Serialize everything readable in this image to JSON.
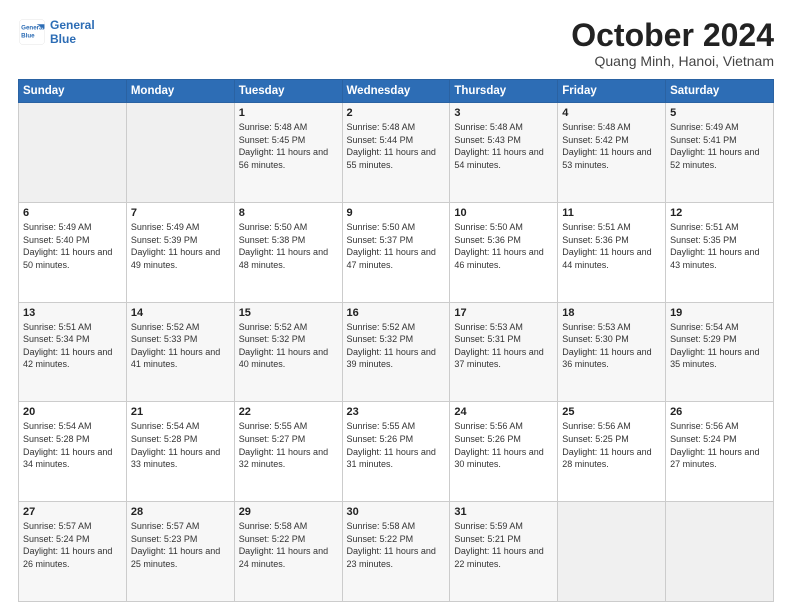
{
  "header": {
    "logo_line1": "General",
    "logo_line2": "Blue",
    "month": "October 2024",
    "location": "Quang Minh, Hanoi, Vietnam"
  },
  "weekdays": [
    "Sunday",
    "Monday",
    "Tuesday",
    "Wednesday",
    "Thursday",
    "Friday",
    "Saturday"
  ],
  "weeks": [
    [
      {
        "day": "",
        "info": ""
      },
      {
        "day": "",
        "info": ""
      },
      {
        "day": "1",
        "info": "Sunrise: 5:48 AM\nSunset: 5:45 PM\nDaylight: 11 hours and 56 minutes."
      },
      {
        "day": "2",
        "info": "Sunrise: 5:48 AM\nSunset: 5:44 PM\nDaylight: 11 hours and 55 minutes."
      },
      {
        "day": "3",
        "info": "Sunrise: 5:48 AM\nSunset: 5:43 PM\nDaylight: 11 hours and 54 minutes."
      },
      {
        "day": "4",
        "info": "Sunrise: 5:48 AM\nSunset: 5:42 PM\nDaylight: 11 hours and 53 minutes."
      },
      {
        "day": "5",
        "info": "Sunrise: 5:49 AM\nSunset: 5:41 PM\nDaylight: 11 hours and 52 minutes."
      }
    ],
    [
      {
        "day": "6",
        "info": "Sunrise: 5:49 AM\nSunset: 5:40 PM\nDaylight: 11 hours and 50 minutes."
      },
      {
        "day": "7",
        "info": "Sunrise: 5:49 AM\nSunset: 5:39 PM\nDaylight: 11 hours and 49 minutes."
      },
      {
        "day": "8",
        "info": "Sunrise: 5:50 AM\nSunset: 5:38 PM\nDaylight: 11 hours and 48 minutes."
      },
      {
        "day": "9",
        "info": "Sunrise: 5:50 AM\nSunset: 5:37 PM\nDaylight: 11 hours and 47 minutes."
      },
      {
        "day": "10",
        "info": "Sunrise: 5:50 AM\nSunset: 5:36 PM\nDaylight: 11 hours and 46 minutes."
      },
      {
        "day": "11",
        "info": "Sunrise: 5:51 AM\nSunset: 5:36 PM\nDaylight: 11 hours and 44 minutes."
      },
      {
        "day": "12",
        "info": "Sunrise: 5:51 AM\nSunset: 5:35 PM\nDaylight: 11 hours and 43 minutes."
      }
    ],
    [
      {
        "day": "13",
        "info": "Sunrise: 5:51 AM\nSunset: 5:34 PM\nDaylight: 11 hours and 42 minutes."
      },
      {
        "day": "14",
        "info": "Sunrise: 5:52 AM\nSunset: 5:33 PM\nDaylight: 11 hours and 41 minutes."
      },
      {
        "day": "15",
        "info": "Sunrise: 5:52 AM\nSunset: 5:32 PM\nDaylight: 11 hours and 40 minutes."
      },
      {
        "day": "16",
        "info": "Sunrise: 5:52 AM\nSunset: 5:32 PM\nDaylight: 11 hours and 39 minutes."
      },
      {
        "day": "17",
        "info": "Sunrise: 5:53 AM\nSunset: 5:31 PM\nDaylight: 11 hours and 37 minutes."
      },
      {
        "day": "18",
        "info": "Sunrise: 5:53 AM\nSunset: 5:30 PM\nDaylight: 11 hours and 36 minutes."
      },
      {
        "day": "19",
        "info": "Sunrise: 5:54 AM\nSunset: 5:29 PM\nDaylight: 11 hours and 35 minutes."
      }
    ],
    [
      {
        "day": "20",
        "info": "Sunrise: 5:54 AM\nSunset: 5:28 PM\nDaylight: 11 hours and 34 minutes."
      },
      {
        "day": "21",
        "info": "Sunrise: 5:54 AM\nSunset: 5:28 PM\nDaylight: 11 hours and 33 minutes."
      },
      {
        "day": "22",
        "info": "Sunrise: 5:55 AM\nSunset: 5:27 PM\nDaylight: 11 hours and 32 minutes."
      },
      {
        "day": "23",
        "info": "Sunrise: 5:55 AM\nSunset: 5:26 PM\nDaylight: 11 hours and 31 minutes."
      },
      {
        "day": "24",
        "info": "Sunrise: 5:56 AM\nSunset: 5:26 PM\nDaylight: 11 hours and 30 minutes."
      },
      {
        "day": "25",
        "info": "Sunrise: 5:56 AM\nSunset: 5:25 PM\nDaylight: 11 hours and 28 minutes."
      },
      {
        "day": "26",
        "info": "Sunrise: 5:56 AM\nSunset: 5:24 PM\nDaylight: 11 hours and 27 minutes."
      }
    ],
    [
      {
        "day": "27",
        "info": "Sunrise: 5:57 AM\nSunset: 5:24 PM\nDaylight: 11 hours and 26 minutes."
      },
      {
        "day": "28",
        "info": "Sunrise: 5:57 AM\nSunset: 5:23 PM\nDaylight: 11 hours and 25 minutes."
      },
      {
        "day": "29",
        "info": "Sunrise: 5:58 AM\nSunset: 5:22 PM\nDaylight: 11 hours and 24 minutes."
      },
      {
        "day": "30",
        "info": "Sunrise: 5:58 AM\nSunset: 5:22 PM\nDaylight: 11 hours and 23 minutes."
      },
      {
        "day": "31",
        "info": "Sunrise: 5:59 AM\nSunset: 5:21 PM\nDaylight: 11 hours and 22 minutes."
      },
      {
        "day": "",
        "info": ""
      },
      {
        "day": "",
        "info": ""
      }
    ]
  ]
}
